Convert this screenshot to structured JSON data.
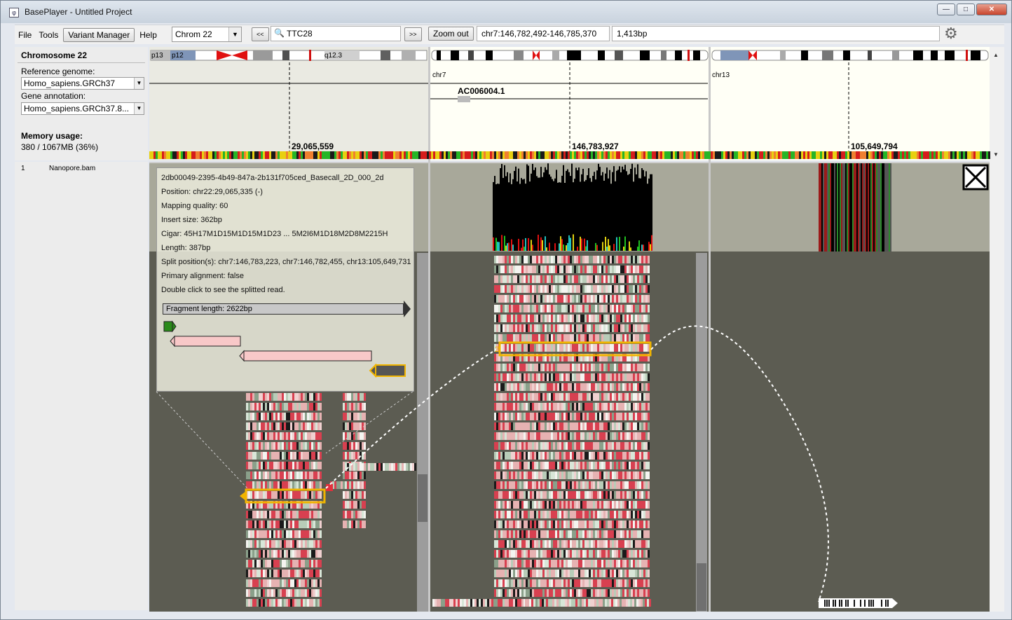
{
  "window": {
    "title": "BasePlayer - Untitled Project",
    "app_icon": "bp-logo-icon"
  },
  "toolbar": {
    "menu_file": "File",
    "menu_tools": "Tools",
    "variant_manager": "Variant Manager",
    "menu_help": "Help",
    "chrom_select": "Chrom  22",
    "back_label": "<<",
    "search_value": "TTC28",
    "forward_label": ">>",
    "zoom_out": "Zoom out",
    "position": "chr7:146,782,492-146,785,370",
    "width": "1,413bp",
    "settings_icon": "gear-icon"
  },
  "sidebar": {
    "title": "Chromosome 22",
    "ref_label": "Reference genome:",
    "ref_value": "Homo_sapiens.GRCh37",
    "ann_label": "Gene annotation:",
    "ann_value": "Homo_sapiens.GRCh37.8...",
    "mem_label": "Memory usage:",
    "mem_value": "380 / 1067MB (36%)"
  },
  "samples": [
    {
      "index": "1",
      "name": "Nanopore.bam"
    }
  ],
  "chrom_panels": [
    {
      "band_left": "p13",
      "band_mid": "p12",
      "band_right": "q12.3",
      "chr": "",
      "gene": "",
      "coord": "29,065,559"
    },
    {
      "chr": "chr7",
      "gene": "AC006004.1",
      "coord": "146,783,927"
    },
    {
      "chr": "chr13",
      "gene": "",
      "coord": "105,649,794"
    }
  ],
  "popup": {
    "read_name": "2db00049-2395-4b49-847a-2b131f705ced_Basecall_2D_000_2d",
    "position": "Position: chr22:29,065,335 (-)",
    "mapq": "Mapping quality: 60",
    "insert": "Insert size: 362bp",
    "cigar": "Cigar: 45H17M1D15M1D15M1D23 ... 5M2I6M1D18M2D8M2215H",
    "length": "Length: 387bp",
    "split": "Split position(s): chr7:146,783,223, chr7:146,782,455, chr13:105,649,731",
    "primary": "Primary alignment: false",
    "hint": "Double click to see the splitted read.",
    "fragment": "Fragment length: 2622bp"
  },
  "colors": {
    "track_bg": "#5c5c52",
    "coverage_bg": "#a8a89a",
    "highlight": "#f0b400",
    "mismatch": "#e0303c"
  }
}
